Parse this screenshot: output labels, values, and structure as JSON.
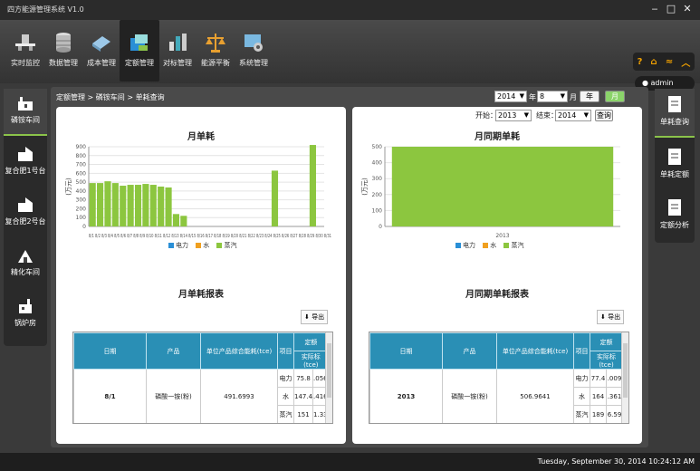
{
  "app": {
    "title": "四方能源管理系统 V1.0"
  },
  "window_controls": {
    "minimize": "‒",
    "maximize": "□",
    "close": "✕"
  },
  "menu": [
    {
      "label": "实时监控",
      "icon": "monitor-icon"
    },
    {
      "label": "数据管理",
      "icon": "database-icon"
    },
    {
      "label": "成本管理",
      "icon": "cost-icon"
    },
    {
      "label": "定额管理",
      "icon": "quota-icon",
      "active": true
    },
    {
      "label": "对标管理",
      "icon": "benchmark-icon"
    },
    {
      "label": "能源平衡",
      "icon": "balance-icon"
    },
    {
      "label": "系统管理",
      "icon": "settings-icon"
    }
  ],
  "topright": {
    "icons": [
      "help-icon",
      "home-icon",
      "rss-icon",
      "collapse-icon"
    ],
    "user": "admin"
  },
  "left_nav": [
    {
      "label": "磷铵车间",
      "active": true
    },
    {
      "label": "复合肥1号台"
    },
    {
      "label": "复合肥2号台"
    },
    {
      "label": "精化车间"
    },
    {
      "label": "锅炉房"
    }
  ],
  "right_nav": [
    {
      "label": "单耗查询",
      "active": true
    },
    {
      "label": "单耗定额"
    },
    {
      "label": "定额分析"
    }
  ],
  "breadcrumb": "定额管理 > 磷铵车间 > 单耗查询",
  "filters": {
    "year": "2014",
    "year_unit": "年",
    "month": "8",
    "month_unit": "月",
    "btn_year": "年",
    "btn_month": "月",
    "start_label": "开始：",
    "start": "2013",
    "end_label": "结束：",
    "end": "2014",
    "query": "查询"
  },
  "colors": {
    "electric": "#2a8fd6",
    "water": "#f0a020",
    "steam": "#8cc63f",
    "header": "#2a8fb5"
  },
  "legend": [
    "电力",
    "水",
    "蒸汽"
  ],
  "left_panel": {
    "chart_title": "月单耗",
    "report_title": "月单耗报表",
    "export": "导出",
    "table": {
      "headers": [
        "日期",
        "产品",
        "单位产品综合能耗(tce)",
        "项目",
        "定额",
        "实际标(tce)"
      ],
      "rows": [
        {
          "date": "8/1",
          "product": "磷酸一铵(粉)",
          "value": "491.6993",
          "items": [
            [
              "电力",
              "75.8",
              ".056"
            ],
            [
              "水",
              "147.4",
              ".416"
            ],
            [
              "蒸汽",
              "151",
              "1.33"
            ]
          ]
        }
      ]
    }
  },
  "right_panel": {
    "chart_title": "月同期单耗",
    "report_title": "月同期单耗报表",
    "export": "导出",
    "table": {
      "headers": [
        "日期",
        "产品",
        "单位产品综合能耗(tce)",
        "项目",
        "定额",
        "实际标(tce)"
      ],
      "rows": [
        {
          "date": "2013",
          "product": "磷酸一铵(粉)",
          "value": "506.9641",
          "items": [
            [
              "电力",
              "77.4",
              ".009"
            ],
            [
              "水",
              "164",
              ".361"
            ],
            [
              "蒸汽",
              "189",
              "6.59"
            ]
          ]
        }
      ]
    }
  },
  "chart_data": [
    {
      "type": "bar",
      "title": "月单耗",
      "ylabel": "(万元)",
      "ylim": [
        0,
        900
      ],
      "yticks": [
        0,
        100,
        200,
        300,
        400,
        500,
        600,
        700,
        800,
        900
      ],
      "categories": [
        "8/1",
        "8/2",
        "8/3",
        "8/4",
        "8/5",
        "8/6",
        "8/7",
        "8/8",
        "8/9",
        "8/10",
        "8/11",
        "8/12",
        "8/13",
        "8/14",
        "8/15",
        "8/16",
        "8/17",
        "8/18",
        "8/19",
        "8/20",
        "8/21",
        "8/22",
        "8/23",
        "8/24",
        "8/25",
        "8/26",
        "8/27",
        "8/28",
        "8/29",
        "8/30",
        "8/31"
      ],
      "xtick_text": "8/1 8/2 8/3 8/4 8/5 8/6 8/7 8/8 8/9 8/10 8/11 8/12 8/13 8/14 8/15 8/16 8/17 8/18 8/19 8/20 8/21 8/22 8/23 8/24 8/25 8/26 8/27 8/28 8/29 8/30 8/31",
      "series": [
        {
          "name": "蒸汽",
          "values": [
            490,
            490,
            510,
            490,
            460,
            470,
            470,
            480,
            470,
            450,
            440,
            140,
            120,
            0,
            0,
            0,
            0,
            0,
            0,
            0,
            0,
            0,
            0,
            0,
            630,
            0,
            0,
            0,
            0,
            920,
            0
          ]
        }
      ],
      "legend": [
        "电力",
        "水",
        "蒸汽"
      ],
      "legend_position": "bottom",
      "grid": true
    },
    {
      "type": "bar",
      "title": "月同期单耗",
      "ylabel": "(万元)",
      "ylim": [
        0,
        500
      ],
      "yticks": [
        0,
        100,
        200,
        300,
        400,
        500
      ],
      "categories": [
        "2013"
      ],
      "series": [
        {
          "name": "蒸汽",
          "values": [
            500
          ]
        }
      ],
      "legend": [
        "电力",
        "水",
        "蒸汽"
      ],
      "legend_position": "bottom",
      "grid": true
    }
  ],
  "status": {
    "datetime": "Tuesday, September 30, 2014 10:24:12 AM"
  }
}
